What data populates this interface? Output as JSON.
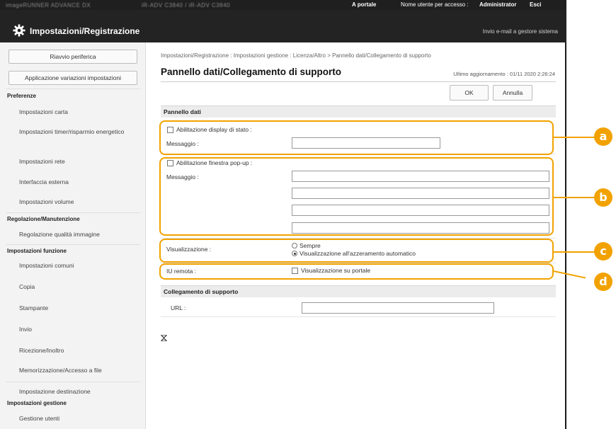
{
  "topbar": {
    "device": "imageRUNNER ADVANCE DX",
    "device_info": "iR-ADV C3840 / iR-ADV C3840",
    "portal": "A portale",
    "user_label": "Nome utente per accesso :",
    "user": "Administrator",
    "logout": "Esci"
  },
  "header": {
    "title": "Impostazioni/Registrazione",
    "mail_link": "Invio e-mail a gestore sistema"
  },
  "sidebar": {
    "restart_btn": "Riavvio periferica",
    "apply_btn": "Applicazione variazioni impostazioni",
    "sections": [
      {
        "title": "Preferenze",
        "items": [
          "Impostazioni carta",
          "Impostazioni timer/risparmio energetico",
          "Impostazioni rete",
          "Interfaccia esterna",
          "Impostazioni volume"
        ]
      },
      {
        "title": "Regolazione/Manutenzione",
        "items": [
          "Regolazione qualità immagine"
        ]
      },
      {
        "title": "Impostazioni funzione",
        "items": [
          "Impostazioni comuni",
          "Copia",
          "Stampante",
          "Invio",
          "Ricezione/Inoltro",
          "Memorizzazione/Accesso a file"
        ]
      },
      {
        "title": "",
        "items": [
          "Impostazione destinazione"
        ]
      },
      {
        "title": "Impostazioni gestione",
        "items": [
          "Gestione utenti"
        ]
      }
    ]
  },
  "main": {
    "breadcrumb": "Impostazioni/Registrazione : Impostazioni gestione : Licenza/Altro > Pannello dati/Collegamento di supporto",
    "title": "Pannello dati/Collegamento di supporto",
    "last_updated": "Ultimo aggiornamento : 01/11 2020 2:26:24",
    "ok_btn": "OK",
    "cancel_btn": "Annulla",
    "data_panel": {
      "heading": "Pannello dati",
      "status_display_label": "Abilitazione display di stato :",
      "status_message_label": "Messaggio :",
      "popup_label": "Abilitazione finestra pop-up :",
      "popup_message_label": "Messaggio :",
      "display_label": "Visualizzazione :",
      "display_options": [
        "Sempre",
        "Visualizzazione all'azzeramento automatico"
      ],
      "display_selected": 1,
      "remote_ui_label": "IU remota :",
      "remote_ui_option": "Visualizzazione su portale"
    },
    "support_link": {
      "heading": "Collegamento di supporto",
      "url_label": "URL :"
    },
    "collapse_icon": "collapse-arrows-icon"
  },
  "callouts": [
    "a",
    "b",
    "c",
    "d"
  ],
  "colors": {
    "accent": "#f2a200",
    "header_bg": "#232323"
  }
}
